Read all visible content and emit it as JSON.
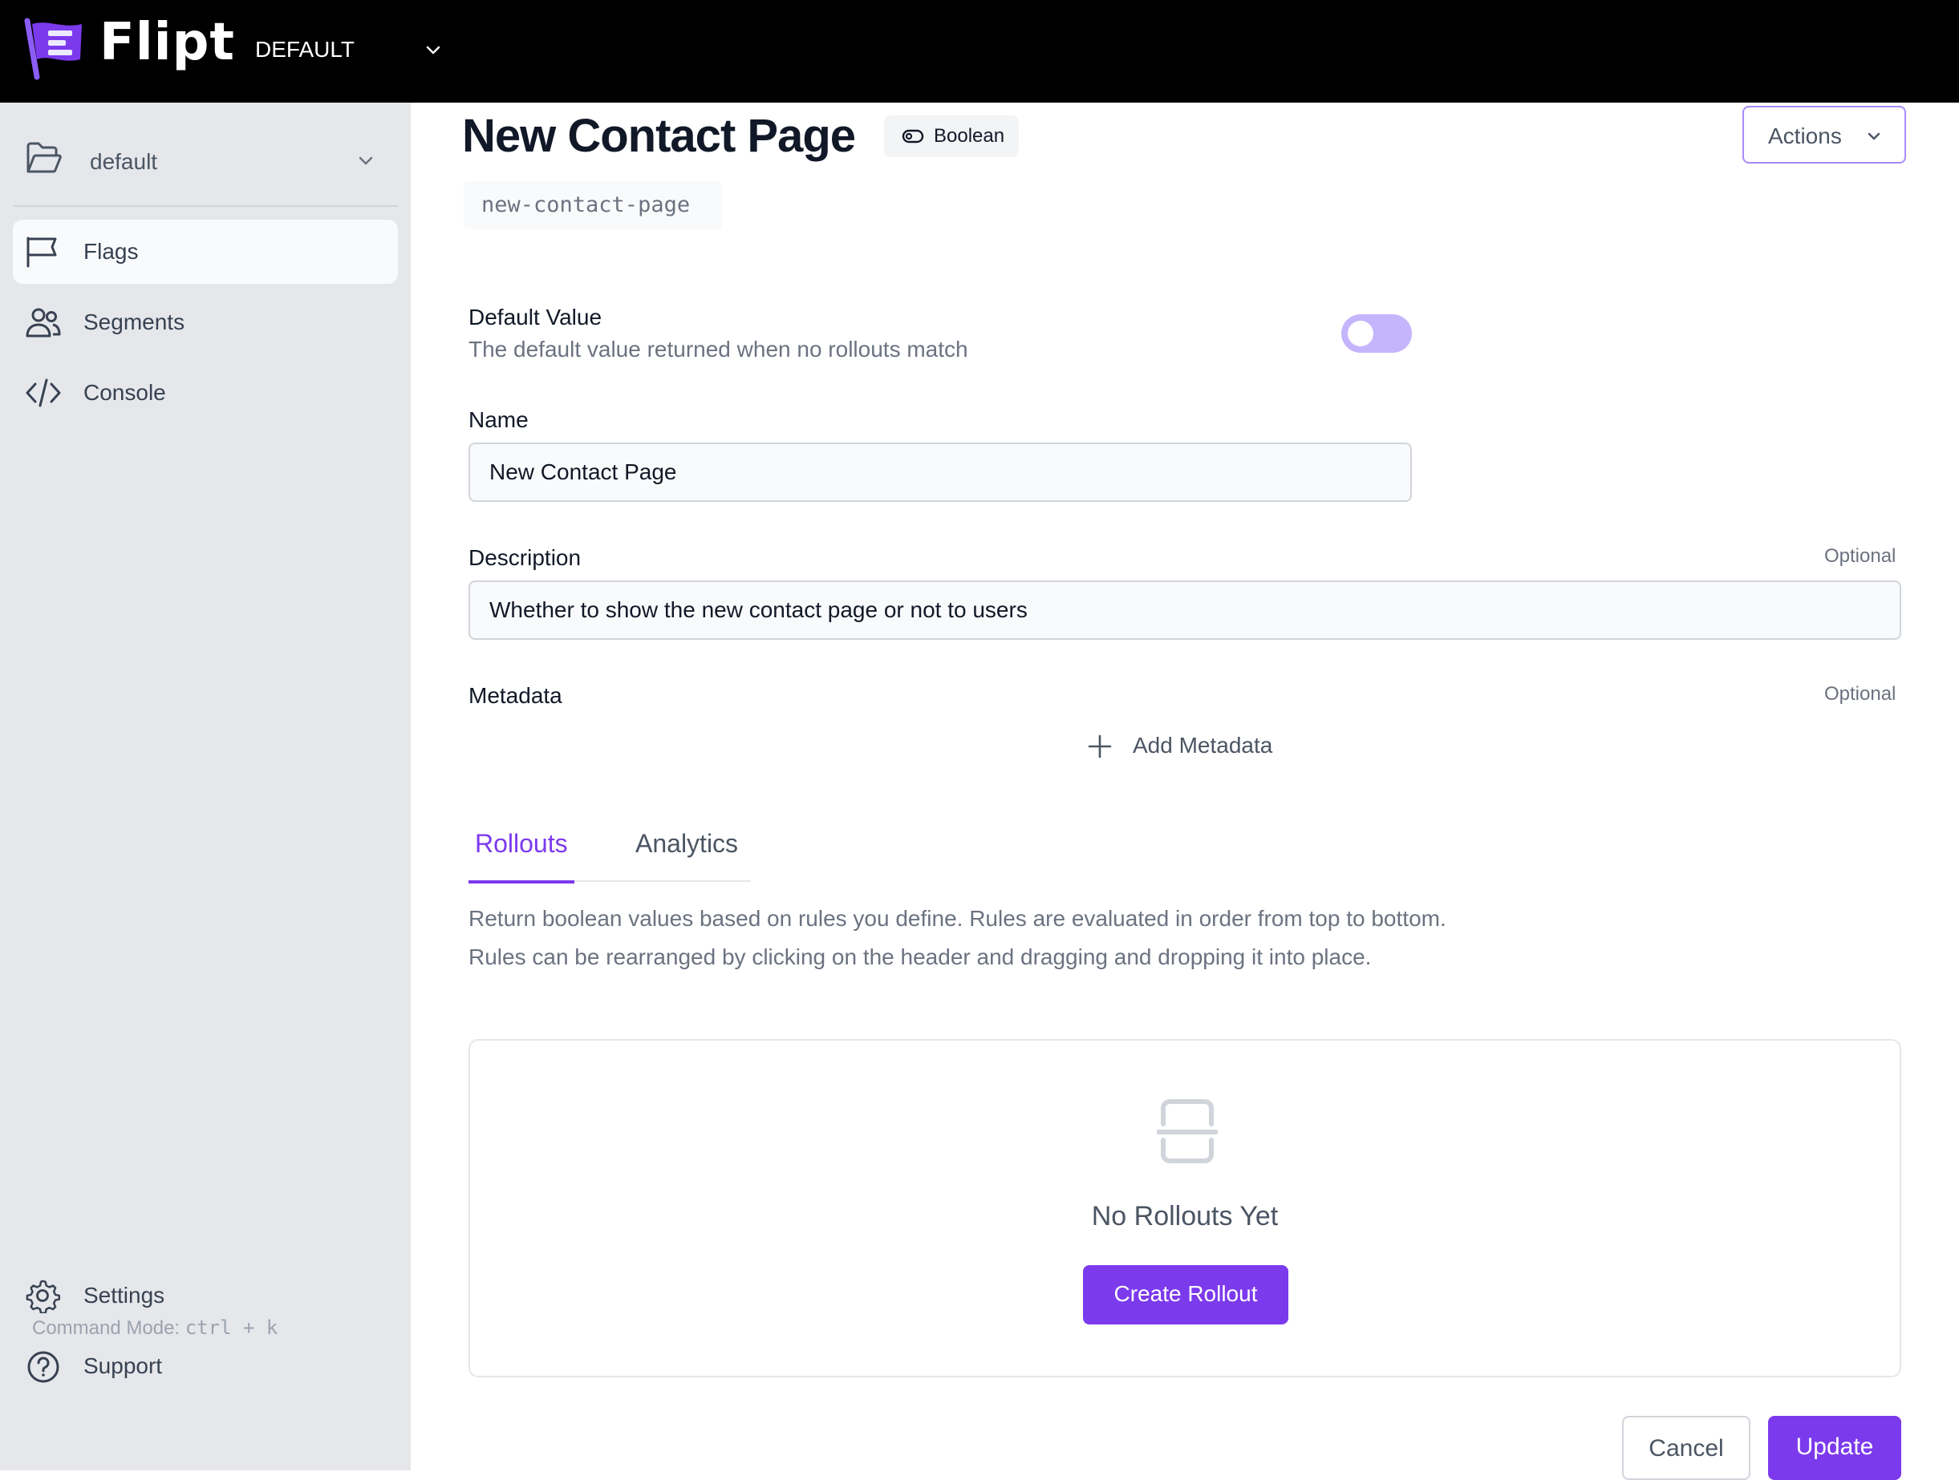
{
  "app": {
    "brand": "Flipt",
    "namespace": "DEFAULT"
  },
  "sidebar": {
    "workspace": "default",
    "items": [
      {
        "label": "Flags",
        "icon": "flag-icon",
        "active": true
      },
      {
        "label": "Segments",
        "icon": "users-icon",
        "active": false
      },
      {
        "label": "Console",
        "icon": "code-icon",
        "active": false
      }
    ],
    "bottom_items": [
      {
        "label": "Settings",
        "icon": "gear-icon"
      },
      {
        "label": "Support",
        "icon": "help-icon"
      }
    ],
    "command_mode_label": "Command Mode:",
    "command_mode_key": "ctrl + k"
  },
  "flag": {
    "title": "New Contact Page",
    "type_badge": "Boolean",
    "key": "new-contact-page",
    "actions_label": "Actions"
  },
  "form": {
    "default_value": {
      "label": "Default Value",
      "help": "The default value returned when no rollouts match",
      "enabled": false
    },
    "name": {
      "label": "Name",
      "value": "New Contact Page"
    },
    "description": {
      "label": "Description",
      "optional": "Optional",
      "value": "Whether to show the new contact page or not to users"
    },
    "metadata": {
      "label": "Metadata",
      "optional": "Optional",
      "add_label": "Add Metadata"
    }
  },
  "tabs": [
    {
      "label": "Rollouts",
      "active": true
    },
    {
      "label": "Analytics",
      "active": false
    }
  ],
  "rollouts": {
    "description_line1": "Return boolean values based on rules you define. Rules are evaluated in order from top to bottom.",
    "description_line2": "Rules can be rearranged by clicking on the header and dragging and dropping it into place.",
    "empty_title": "No Rollouts Yet",
    "create_label": "Create Rollout"
  },
  "footer": {
    "cancel_label": "Cancel",
    "update_label": "Update"
  },
  "colors": {
    "accent": "#7c3aed",
    "toggle_off": "#c4b5fd",
    "sidebar_bg": "#e5e7eb",
    "topbar_bg": "#000000"
  }
}
